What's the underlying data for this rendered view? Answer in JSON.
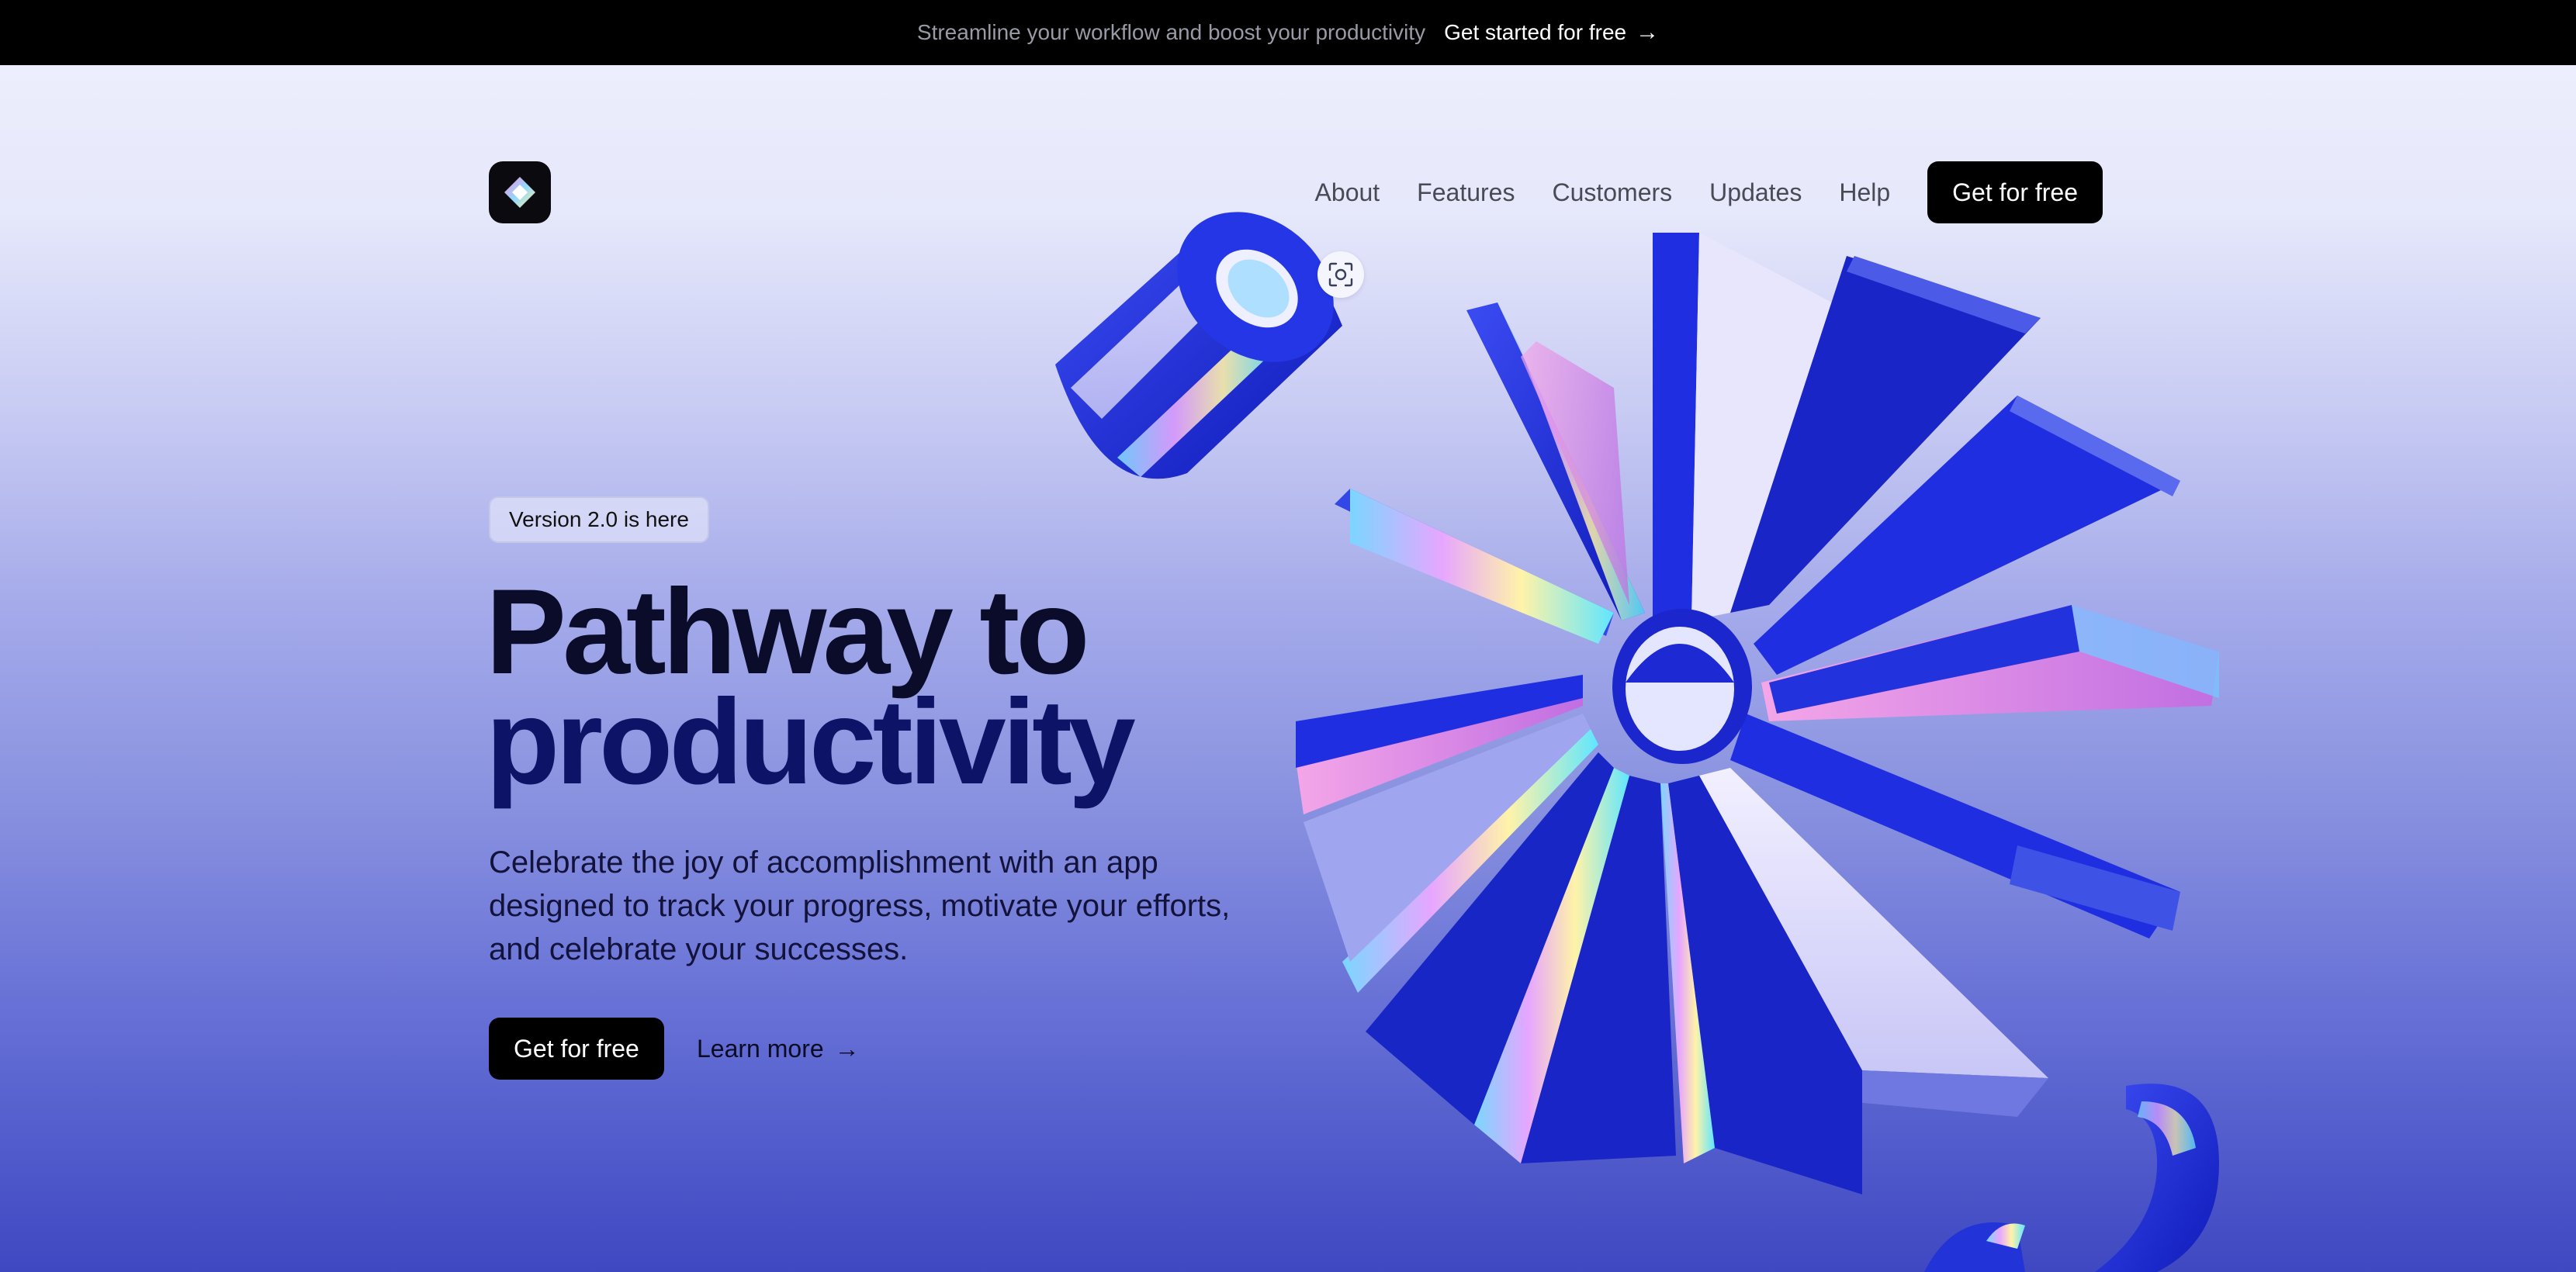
{
  "announcement": {
    "text": "Streamline your workflow and boost your productivity",
    "link_label": "Get started for free",
    "arrow": "→"
  },
  "nav": {
    "items": [
      {
        "label": "About"
      },
      {
        "label": "Features"
      },
      {
        "label": "Customers"
      },
      {
        "label": "Updates"
      },
      {
        "label": "Help"
      }
    ],
    "cta_label": "Get for free"
  },
  "hero": {
    "badge": "Version 2.0 is here",
    "title_line1": "Pathway to",
    "title_line2": "productivity",
    "subtitle": "Celebrate the joy of accomplishment with an app designed to track your progress, motivate your efforts, and celebrate your successes.",
    "primary_cta": "Get for free",
    "secondary_cta": "Learn more",
    "secondary_arrow": "→"
  },
  "icons": {
    "logo": "diamond-logo-icon",
    "scan": "scan-focus-icon"
  },
  "colors": {
    "topbar_bg": "#000000",
    "cta_bg": "#000000",
    "art_blue": "#1f2ee0",
    "art_light": "#dcdcfb",
    "title_dark": "#0b0c2a",
    "title_navy": "#0d1366"
  }
}
